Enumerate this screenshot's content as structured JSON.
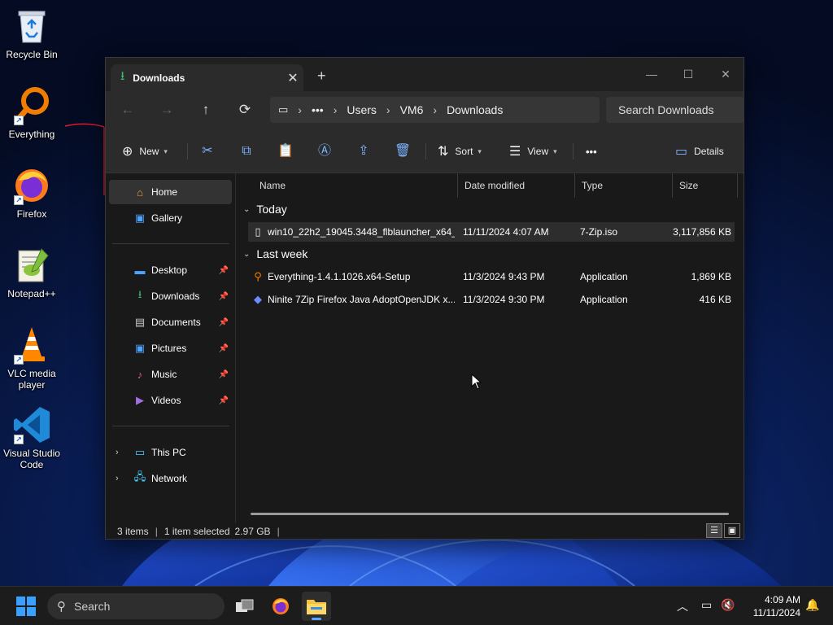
{
  "desktop": {
    "icons": [
      {
        "label": "Recycle Bin"
      },
      {
        "label": "Everything"
      },
      {
        "label": "Firefox"
      },
      {
        "label": "Notepad++"
      },
      {
        "label": "VLC media player"
      },
      {
        "label": "Visual Studio Code"
      }
    ]
  },
  "window": {
    "tab_title": "Downloads",
    "tab_close": "✕",
    "new_tab": "+",
    "controls": {
      "minimize": "—",
      "maximize": "☐",
      "close": "✕"
    }
  },
  "address": {
    "breadcrumb": [
      "Users",
      "VM6",
      "Downloads"
    ],
    "search_placeholder": "Search Downloads"
  },
  "toolbar": {
    "new_label": "New",
    "sort_label": "Sort",
    "view_label": "View",
    "more_label": "•••",
    "details_label": "Details"
  },
  "nav": {
    "home": "Home",
    "gallery": "Gallery",
    "quick_access": [
      {
        "label": "Desktop"
      },
      {
        "label": "Downloads"
      },
      {
        "label": "Documents"
      },
      {
        "label": "Pictures"
      },
      {
        "label": "Music"
      },
      {
        "label": "Videos"
      }
    ],
    "this_pc": "This PC",
    "network": "Network"
  },
  "columns": {
    "name": "Name",
    "date": "Date modified",
    "type": "Type",
    "size": "Size"
  },
  "groups": [
    {
      "label": "Today",
      "files": [
        {
          "name": "win10_22h2_19045.3448_flblauncher_x64_...",
          "date": "11/11/2024 4:07 AM",
          "type": "7-Zip.iso",
          "size": "3,117,856 KB",
          "selected": true,
          "icon": "file-icon"
        }
      ]
    },
    {
      "label": "Last week",
      "files": [
        {
          "name": "Everything-1.4.1.1026.x64-Setup",
          "date": "11/3/2024 9:43 PM",
          "type": "Application",
          "size": "1,869 KB",
          "selected": false,
          "icon": "everything-icon"
        },
        {
          "name": "Ninite 7Zip Firefox Java AdoptOpenJDK x...",
          "date": "11/3/2024 9:30 PM",
          "type": "Application",
          "size": "416 KB",
          "selected": false,
          "icon": "ninite-icon"
        }
      ]
    }
  ],
  "status": {
    "items": "3 items",
    "selected": "1 item selected",
    "size": "2.97 GB"
  },
  "taskbar": {
    "search_label": "Search",
    "time": "4:09 AM",
    "date": "11/11/2024"
  }
}
